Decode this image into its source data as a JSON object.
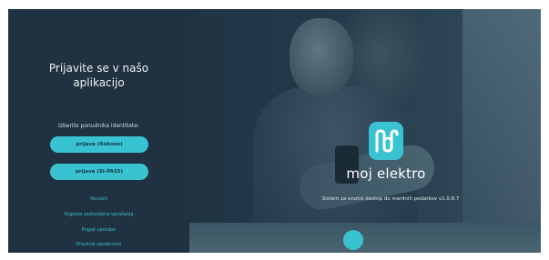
{
  "login": {
    "title_line1": "Prijavite se v našo",
    "title_line2": "aplikacijo",
    "prompt": "Izberite ponudnika identitete:",
    "buttons": [
      {
        "label": "prijava (Rekono)"
      },
      {
        "label": "prijava (SI-PASS)"
      }
    ],
    "links": [
      {
        "label": "Novosti"
      },
      {
        "label": "Pogosto zastavljena vprašanja"
      },
      {
        "label": "Pogoji uporabe"
      },
      {
        "label": "Pravilnik zasebnosti"
      }
    ]
  },
  "brand": {
    "name": "moj elektro",
    "tagline": "Sistem za enotni dostop do merilnih podatkov v1.0.8.7",
    "logo_icon": "me-monogram-icon",
    "accent_color": "#39c3d2"
  },
  "colors": {
    "panel": "#203241",
    "text": "#ffffff",
    "link": "#35c0cf"
  }
}
